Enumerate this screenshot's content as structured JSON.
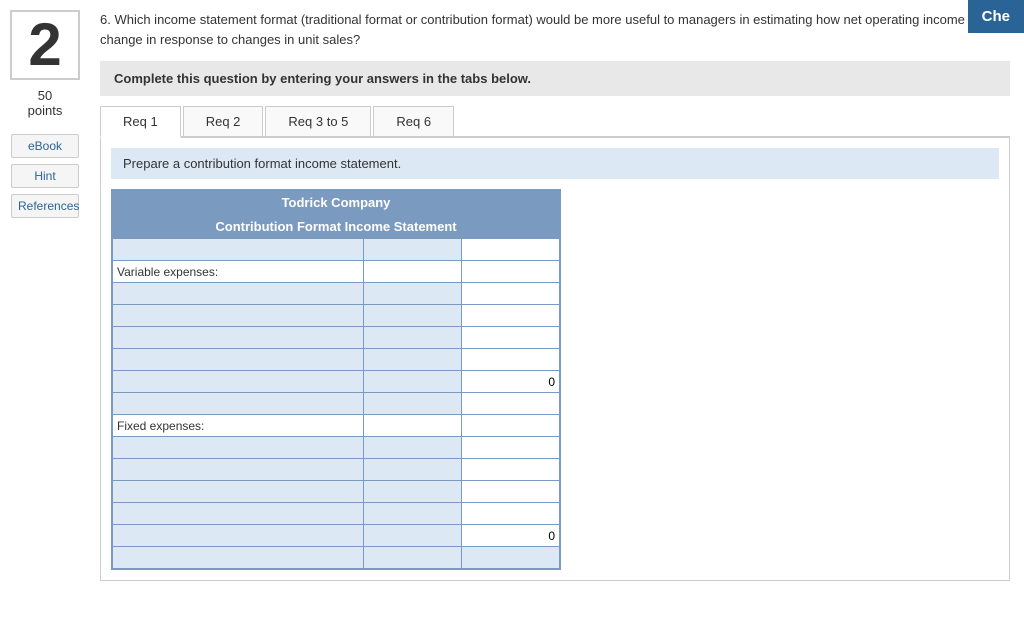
{
  "topbar": {
    "label": "Che"
  },
  "question": {
    "number": "2",
    "points": "50",
    "points_label": "points",
    "text": "6. Which income statement format (traditional format or contribution format) would be more useful to managers in estimating how net operating income will change in response to changes in unit sales?"
  },
  "sidebar": {
    "ebook_label": "eBook",
    "hint_label": "Hint",
    "references_label": "References"
  },
  "instruction": {
    "text": "Complete this question by entering your answers in the tabs below."
  },
  "tabs": [
    {
      "label": "Req 1",
      "active": false
    },
    {
      "label": "Req 2",
      "active": false
    },
    {
      "label": "Req 3 to 5",
      "active": false
    },
    {
      "label": "Req 6",
      "active": false
    }
  ],
  "active_tab_index": 0,
  "req_instruction": "Prepare a contribution format income statement.",
  "table": {
    "company": "Todrick Company",
    "title": "Contribution Format Income Statement",
    "rows": [
      {
        "type": "input_row",
        "label": "",
        "amount": "",
        "total": ""
      },
      {
        "type": "label_row",
        "label": "Variable expenses:",
        "amount": "",
        "total": ""
      },
      {
        "type": "input_row",
        "label": "",
        "amount": "",
        "total": ""
      },
      {
        "type": "input_row",
        "label": "",
        "amount": "",
        "total": ""
      },
      {
        "type": "input_row",
        "label": "",
        "amount": "",
        "total": ""
      },
      {
        "type": "input_row",
        "label": "",
        "amount": "",
        "total": ""
      },
      {
        "type": "input_row_total",
        "label": "",
        "amount": "",
        "total": "0"
      },
      {
        "type": "input_row",
        "label": "",
        "amount": "",
        "total": ""
      },
      {
        "type": "label_row",
        "label": "Fixed expenses:",
        "amount": "",
        "total": ""
      },
      {
        "type": "input_row",
        "label": "",
        "amount": "",
        "total": ""
      },
      {
        "type": "input_row",
        "label": "",
        "amount": "",
        "total": ""
      },
      {
        "type": "input_row",
        "label": "",
        "amount": "",
        "total": ""
      },
      {
        "type": "input_row",
        "label": "",
        "amount": "",
        "total": ""
      },
      {
        "type": "input_row_total",
        "label": "",
        "amount": "",
        "total": "0"
      },
      {
        "type": "input_row",
        "label": "",
        "amount": "",
        "total": ""
      }
    ]
  }
}
